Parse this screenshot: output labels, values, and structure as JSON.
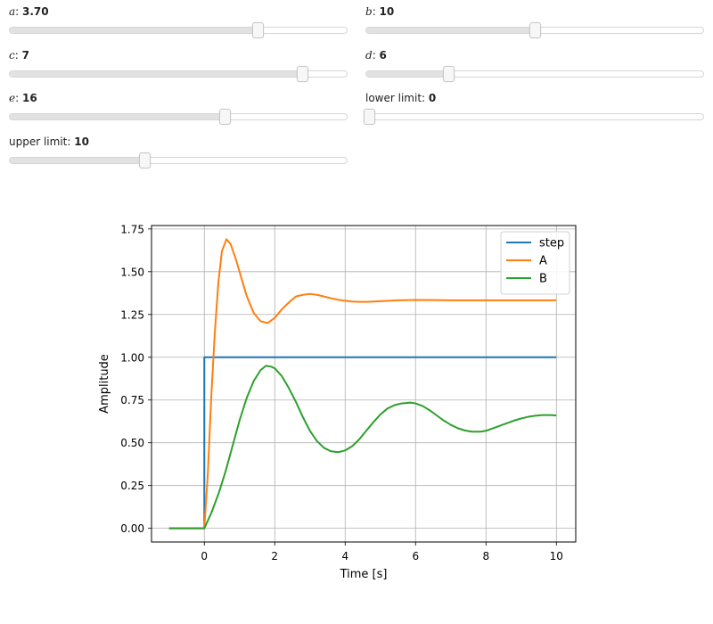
{
  "sliders": [
    {
      "id": "a",
      "var": "a",
      "sep": ": ",
      "label": "",
      "value": 3.7,
      "display": "3.70",
      "min": 0,
      "max": 5
    },
    {
      "id": "b",
      "var": "b",
      "sep": ": ",
      "label": "",
      "value": 10,
      "display": "10",
      "min": 0,
      "max": 20
    },
    {
      "id": "c",
      "var": "c",
      "sep": ": ",
      "label": "",
      "value": 7,
      "display": "7",
      "min": 0,
      "max": 8
    },
    {
      "id": "d",
      "var": "d",
      "sep": ": ",
      "label": "",
      "value": 6,
      "display": "6",
      "min": 0,
      "max": 25
    },
    {
      "id": "e",
      "var": "e",
      "sep": ": ",
      "label": "",
      "value": 16,
      "display": "16",
      "min": 0,
      "max": 25
    },
    {
      "id": "lower",
      "var": "",
      "sep": "",
      "label": "lower limit: ",
      "value": 0,
      "display": "0",
      "min": 0,
      "max": 10
    },
    {
      "id": "upper",
      "var": "",
      "sep": "",
      "label": "upper limit: ",
      "value": 10,
      "display": "10",
      "min": 0,
      "max": 25
    }
  ],
  "chart_data": {
    "type": "line",
    "title": "",
    "xlabel": "Time [s]",
    "ylabel": "Amplitude",
    "xlim": [
      -1.5,
      10.55
    ],
    "ylim": [
      -0.08,
      1.77
    ],
    "xticks": [
      0,
      2,
      4,
      6,
      8,
      10
    ],
    "xticklabels": [
      "0",
      "2",
      "4",
      "6",
      "8",
      "10"
    ],
    "yticks": [
      0.0,
      0.25,
      0.5,
      0.75,
      1.0,
      1.25,
      1.5,
      1.75
    ],
    "yticklabels": [
      "0.00",
      "0.25",
      "0.50",
      "0.75",
      "1.00",
      "1.25",
      "1.50",
      "1.75"
    ],
    "grid": true,
    "legend_position": "upper right",
    "series": [
      {
        "name": "step",
        "color": "#1f77b4",
        "x": [
          -1,
          0,
          0,
          10
        ],
        "y": [
          0,
          0,
          1,
          1
        ]
      },
      {
        "name": "A",
        "color": "#ff7f0e",
        "x": [
          -1,
          0,
          0.1,
          0.2,
          0.3,
          0.4,
          0.5,
          0.63,
          0.75,
          0.9,
          1.0,
          1.2,
          1.4,
          1.6,
          1.8,
          2.0,
          2.2,
          2.4,
          2.6,
          2.8,
          3.0,
          3.2,
          3.4,
          3.6,
          3.8,
          4.0,
          4.2,
          4.4,
          4.6,
          4.8,
          5.0,
          5.5,
          6.0,
          6.5,
          7.0,
          8.0,
          9.0,
          10.0
        ],
        "y": [
          0,
          0,
          0.32,
          0.78,
          1.15,
          1.44,
          1.62,
          1.69,
          1.66,
          1.57,
          1.5,
          1.36,
          1.26,
          1.21,
          1.2,
          1.23,
          1.28,
          1.32,
          1.355,
          1.365,
          1.37,
          1.365,
          1.355,
          1.345,
          1.336,
          1.33,
          1.326,
          1.324,
          1.324,
          1.326,
          1.328,
          1.333,
          1.335,
          1.334,
          1.333,
          1.333,
          1.333,
          1.333
        ]
      },
      {
        "name": "B",
        "color": "#2ca02c",
        "x": [
          -1,
          0,
          0.2,
          0.4,
          0.6,
          0.8,
          1.0,
          1.2,
          1.4,
          1.6,
          1.75,
          1.9,
          2.0,
          2.2,
          2.4,
          2.6,
          2.8,
          3.0,
          3.2,
          3.4,
          3.6,
          3.8,
          4.0,
          4.2,
          4.4,
          4.6,
          4.8,
          5.0,
          5.2,
          5.4,
          5.6,
          5.85,
          6.0,
          6.2,
          6.4,
          6.6,
          6.8,
          7.0,
          7.2,
          7.4,
          7.6,
          7.85,
          8.0,
          8.2,
          8.4,
          8.6,
          8.8,
          9.0,
          9.2,
          9.4,
          9.6,
          9.8,
          10.0
        ],
        "y": [
          0,
          0,
          0.09,
          0.2,
          0.33,
          0.48,
          0.63,
          0.76,
          0.86,
          0.925,
          0.95,
          0.945,
          0.935,
          0.89,
          0.82,
          0.74,
          0.65,
          0.57,
          0.51,
          0.47,
          0.45,
          0.445,
          0.455,
          0.48,
          0.52,
          0.57,
          0.62,
          0.665,
          0.7,
          0.72,
          0.73,
          0.735,
          0.73,
          0.715,
          0.69,
          0.66,
          0.63,
          0.605,
          0.585,
          0.572,
          0.565,
          0.565,
          0.57,
          0.585,
          0.6,
          0.615,
          0.63,
          0.642,
          0.652,
          0.658,
          0.662,
          0.662,
          0.66
        ]
      }
    ]
  }
}
